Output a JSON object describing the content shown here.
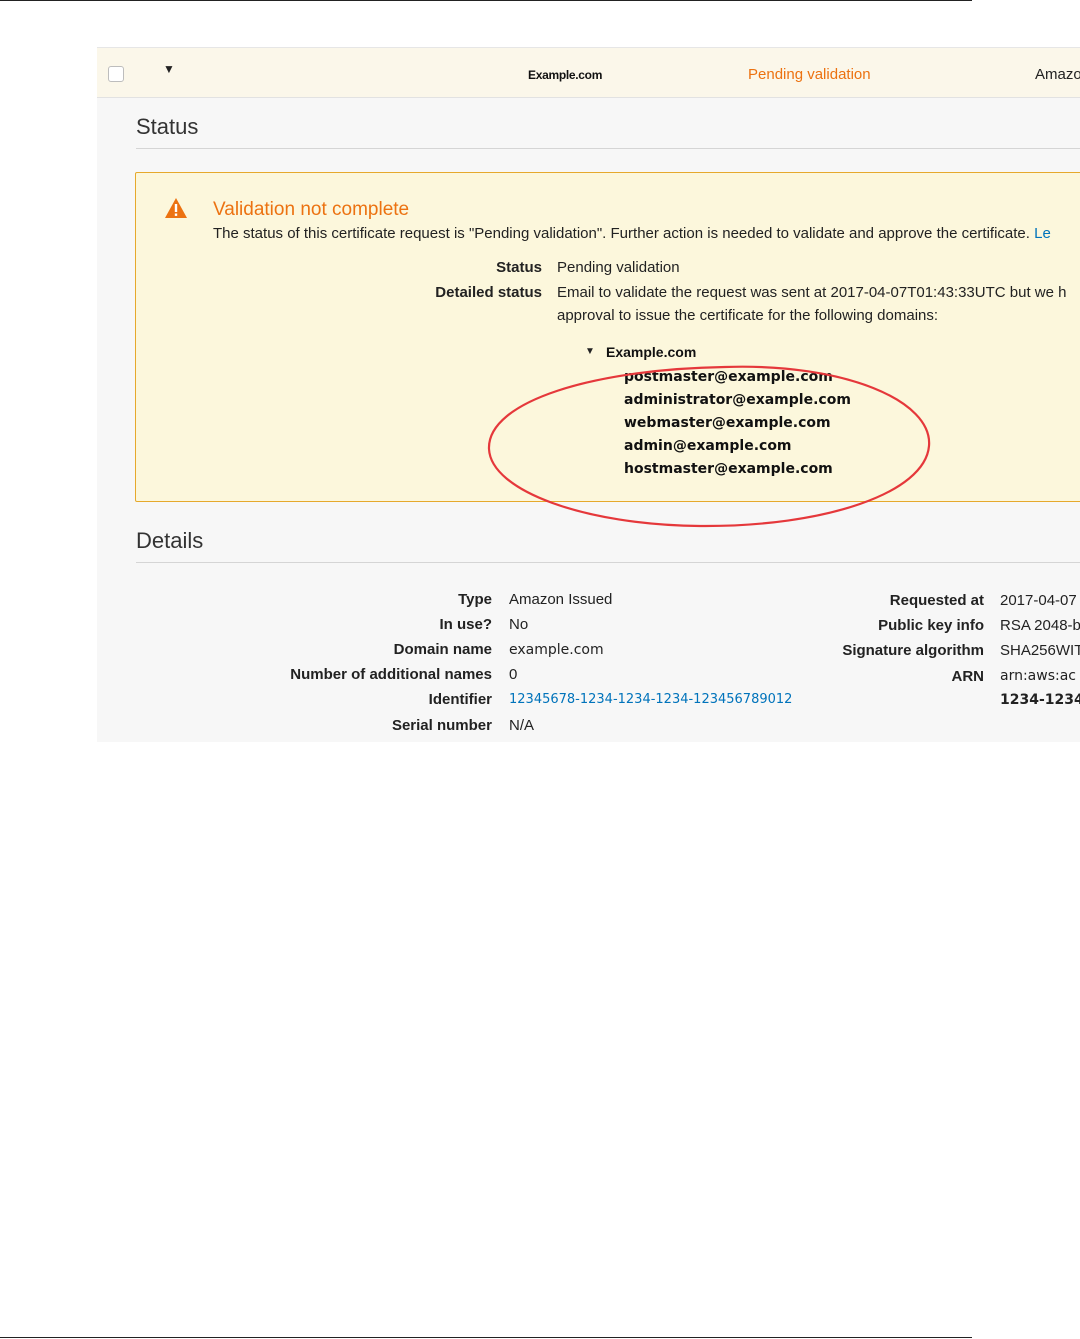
{
  "row": {
    "domain": "Example.com",
    "status": "Pending validation",
    "type": "Amazo"
  },
  "status_section": {
    "title": "Status"
  },
  "alert": {
    "title": "Validation not complete",
    "message": "The status of this certificate request is \"Pending validation\". Further action is needed to validate and approve the certificate.",
    "link_text": "Le",
    "status_label": "Status",
    "status_value": "Pending validation",
    "detailed_label": "Detailed status",
    "detailed_line1": "Email to validate the request was sent at 2017-04-07T01:43:33UTC but we h",
    "detailed_line2": "approval to issue the certificate for the following domains:",
    "tree_domain": "Example.com",
    "emails": [
      "postmaster@example.com",
      "administrator@example.com",
      "webmaster@example.com",
      "admin@example.com",
      "hostmaster@example.com"
    ],
    "annotation_color": "#e5383b"
  },
  "details_section": {
    "title": "Details",
    "left": [
      {
        "label": "Type",
        "value": "Amazon Issued"
      },
      {
        "label": "In use?",
        "value": "No"
      },
      {
        "label": "Domain name",
        "value": "example.com"
      },
      {
        "label": "Number of additional names",
        "value": "0"
      },
      {
        "label": "Identifier",
        "value": "12345678-1234-1234-1234-123456789012"
      },
      {
        "label": "Serial number",
        "value": "N/A"
      }
    ],
    "right": [
      {
        "label": "Requested at",
        "value": "2017-04-07"
      },
      {
        "label": "Public key info",
        "value": "RSA 2048-b"
      },
      {
        "label": "Signature algorithm",
        "value": "SHA256WIT"
      },
      {
        "label": "ARN",
        "value": "arn:aws:ac"
      },
      {
        "label": "",
        "value": "1234-1234-"
      }
    ]
  },
  "colors": {
    "accent_orange": "#ec7211",
    "link_blue": "#0073bb",
    "alert_bg": "#fcf7dc",
    "alert_border": "#e6a92c"
  },
  "icons": {
    "warning": "warning-triangle-icon",
    "caret": "caret-down-icon"
  }
}
